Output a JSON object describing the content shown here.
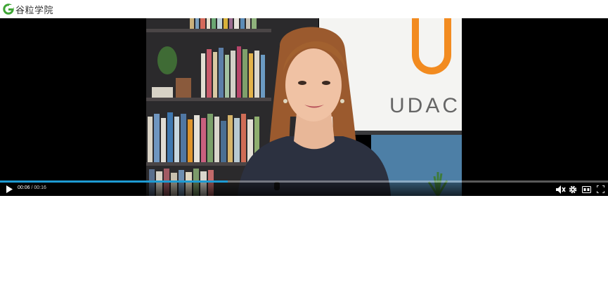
{
  "header": {
    "logo_text": "谷粒学院"
  },
  "video": {
    "whiteboard_text": "UDAC",
    "progress": 0.375,
    "current_time": "00:06",
    "duration": "00:16",
    "time_separator": " / "
  },
  "controls": {
    "icons": [
      "play-icon",
      "volume-muted-icon",
      "gear-icon",
      "captions-icon",
      "fullscreen-icon"
    ],
    "accent_color": "#1e9bd3"
  }
}
